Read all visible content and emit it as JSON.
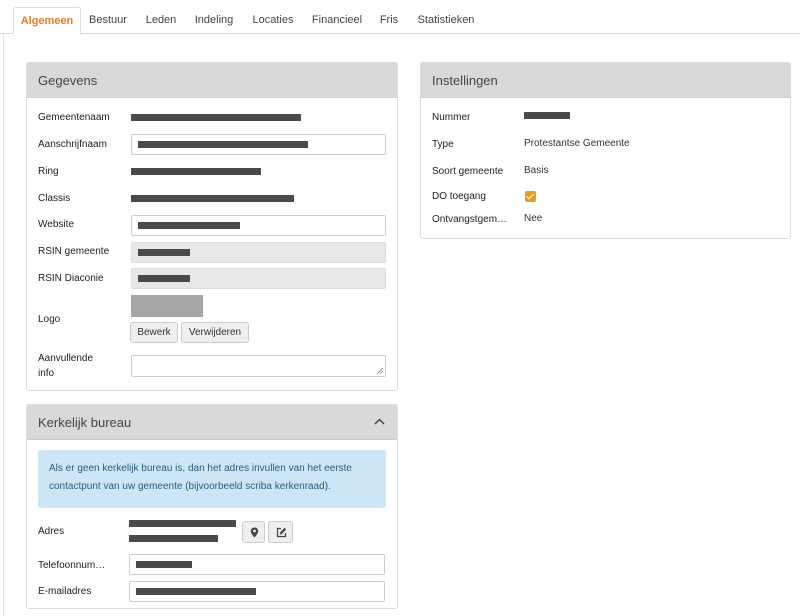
{
  "tabs": [
    {
      "label": "Algemeen",
      "active": true
    },
    {
      "label": "Bestuur"
    },
    {
      "label": "Leden"
    },
    {
      "label": "Indeling"
    },
    {
      "label": "Locaties"
    },
    {
      "label": "Financieel"
    },
    {
      "label": "Fris"
    },
    {
      "label": "Statistieken"
    }
  ],
  "gegevens": {
    "title": "Gegevens",
    "labels": {
      "gemeentenaam": "Gemeentenaam",
      "aanschrijfnaam": "Aanschrijfnaam",
      "ring": "Ring",
      "classis": "Classis",
      "website": "Website",
      "rsin_gemeente": "RSIN gemeente",
      "rsin_diaconie": "RSIN Diaconie",
      "logo": "Logo",
      "aanvullende_info_1": "Aanvullende",
      "aanvullende_info_2": "info"
    },
    "buttons": {
      "bewerk": "Bewerk",
      "verwijderen": "Verwijderen"
    }
  },
  "kerkelijk_bureau": {
    "title": "Kerkelijk bureau",
    "alert": "Als er geen kerkelijk bureau is, dan het adres invullen van het eerste contactpunt van uw gemeente (bijvoorbeeld scriba kerkenraad).",
    "labels": {
      "adres": "Adres",
      "telefoon": "Telefoonnum…",
      "email": "E-mailadres"
    }
  },
  "instellingen": {
    "title": "Instellingen",
    "labels": {
      "nummer": "Nummer",
      "type": "Type",
      "soort": "Soort gemeente",
      "do_toegang": "DO toegang",
      "ontvangst": "Ontvangstgem…"
    },
    "values": {
      "type": "Protestantse Gemeente",
      "soort": "Basis",
      "ontvangst": "Nee"
    },
    "do_toegang_checked": true
  },
  "colors": {
    "accent": "#e67e22",
    "checkbox": "#e8a01c",
    "alert_bg": "#cde6f5",
    "panel_header": "#d9d9d9"
  }
}
